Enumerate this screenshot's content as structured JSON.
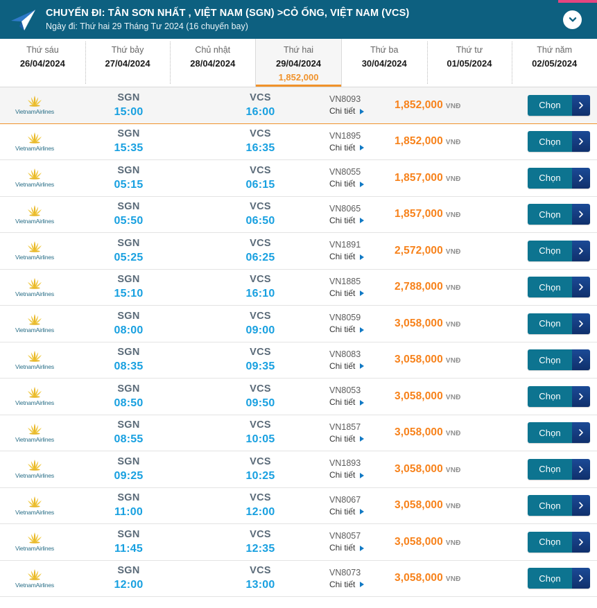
{
  "header": {
    "icon": "paper-plane-icon",
    "title": "CHUYẾN ĐI: TÂN SƠN NHẤT , VIỆT NAM (SGN) >CỎ ỐNG, VIỆT NAM (VCS)",
    "subtitle": "Ngày đi: Thứ hai 29 Tháng Tư 2024 (16 chuyến bay)",
    "collapse_icon": "chevron-down-icon",
    "bg_color": "#0d6080",
    "accent_strip_color": "#e5457f"
  },
  "date_tabs": [
    {
      "day": "Thứ sáu",
      "date": "26/04/2024",
      "price": "",
      "active": false
    },
    {
      "day": "Thứ bảy",
      "date": "27/04/2024",
      "price": "",
      "active": false
    },
    {
      "day": "Chủ nhật",
      "date": "28/04/2024",
      "price": "",
      "active": false
    },
    {
      "day": "Thứ hai",
      "date": "29/04/2024",
      "price": "1,852,000",
      "active": true
    },
    {
      "day": "Thứ ba",
      "date": "30/04/2024",
      "price": "",
      "active": false
    },
    {
      "day": "Thứ tư",
      "date": "01/05/2024",
      "price": "",
      "active": false
    },
    {
      "day": "Thứ năm",
      "date": "02/05/2024",
      "price": "",
      "active": false
    }
  ],
  "labels": {
    "detail": "Chi tiết",
    "choose": "Chọn",
    "currency": "VNĐ",
    "airline_name": "VietnamAirlines"
  },
  "colors": {
    "price": "#f7821b",
    "time": "#18a0e0",
    "airport": "#5a6a78",
    "active_tab_underline": "#f0922b",
    "button_teal": "#0d7490",
    "button_navy": "#123a7a"
  },
  "flights": [
    {
      "airline": "VietnamAirlines",
      "dep_code": "SGN",
      "dep_time": "15:00",
      "arr_code": "VCS",
      "arr_time": "16:00",
      "flight_no": "VN8093",
      "price": "1,852,000",
      "currency": "VNĐ",
      "selected": true
    },
    {
      "airline": "VietnamAirlines",
      "dep_code": "SGN",
      "dep_time": "15:35",
      "arr_code": "VCS",
      "arr_time": "16:35",
      "flight_no": "VN1895",
      "price": "1,852,000",
      "currency": "VNĐ",
      "selected": false
    },
    {
      "airline": "VietnamAirlines",
      "dep_code": "SGN",
      "dep_time": "05:15",
      "arr_code": "VCS",
      "arr_time": "06:15",
      "flight_no": "VN8055",
      "price": "1,857,000",
      "currency": "VNĐ",
      "selected": false
    },
    {
      "airline": "VietnamAirlines",
      "dep_code": "SGN",
      "dep_time": "05:50",
      "arr_code": "VCS",
      "arr_time": "06:50",
      "flight_no": "VN8065",
      "price": "1,857,000",
      "currency": "VNĐ",
      "selected": false
    },
    {
      "airline": "VietnamAirlines",
      "dep_code": "SGN",
      "dep_time": "05:25",
      "arr_code": "VCS",
      "arr_time": "06:25",
      "flight_no": "VN1891",
      "price": "2,572,000",
      "currency": "VNĐ",
      "selected": false
    },
    {
      "airline": "VietnamAirlines",
      "dep_code": "SGN",
      "dep_time": "15:10",
      "arr_code": "VCS",
      "arr_time": "16:10",
      "flight_no": "VN1885",
      "price": "2,788,000",
      "currency": "VNĐ",
      "selected": false
    },
    {
      "airline": "VietnamAirlines",
      "dep_code": "SGN",
      "dep_time": "08:00",
      "arr_code": "VCS",
      "arr_time": "09:00",
      "flight_no": "VN8059",
      "price": "3,058,000",
      "currency": "VNĐ",
      "selected": false
    },
    {
      "airline": "VietnamAirlines",
      "dep_code": "SGN",
      "dep_time": "08:35",
      "arr_code": "VCS",
      "arr_time": "09:35",
      "flight_no": "VN8083",
      "price": "3,058,000",
      "currency": "VNĐ",
      "selected": false
    },
    {
      "airline": "VietnamAirlines",
      "dep_code": "SGN",
      "dep_time": "08:50",
      "arr_code": "VCS",
      "arr_time": "09:50",
      "flight_no": "VN8053",
      "price": "3,058,000",
      "currency": "VNĐ",
      "selected": false
    },
    {
      "airline": "VietnamAirlines",
      "dep_code": "SGN",
      "dep_time": "08:55",
      "arr_code": "VCS",
      "arr_time": "10:05",
      "flight_no": "VN1857",
      "price": "3,058,000",
      "currency": "VNĐ",
      "selected": false
    },
    {
      "airline": "VietnamAirlines",
      "dep_code": "SGN",
      "dep_time": "09:25",
      "arr_code": "VCS",
      "arr_time": "10:25",
      "flight_no": "VN1893",
      "price": "3,058,000",
      "currency": "VNĐ",
      "selected": false
    },
    {
      "airline": "VietnamAirlines",
      "dep_code": "SGN",
      "dep_time": "11:00",
      "arr_code": "VCS",
      "arr_time": "12:00",
      "flight_no": "VN8067",
      "price": "3,058,000",
      "currency": "VNĐ",
      "selected": false
    },
    {
      "airline": "VietnamAirlines",
      "dep_code": "SGN",
      "dep_time": "11:45",
      "arr_code": "VCS",
      "arr_time": "12:35",
      "flight_no": "VN8057",
      "price": "3,058,000",
      "currency": "VNĐ",
      "selected": false
    },
    {
      "airline": "VietnamAirlines",
      "dep_code": "SGN",
      "dep_time": "12:00",
      "arr_code": "VCS",
      "arr_time": "13:00",
      "flight_no": "VN8073",
      "price": "3,058,000",
      "currency": "VNĐ",
      "selected": false
    }
  ]
}
